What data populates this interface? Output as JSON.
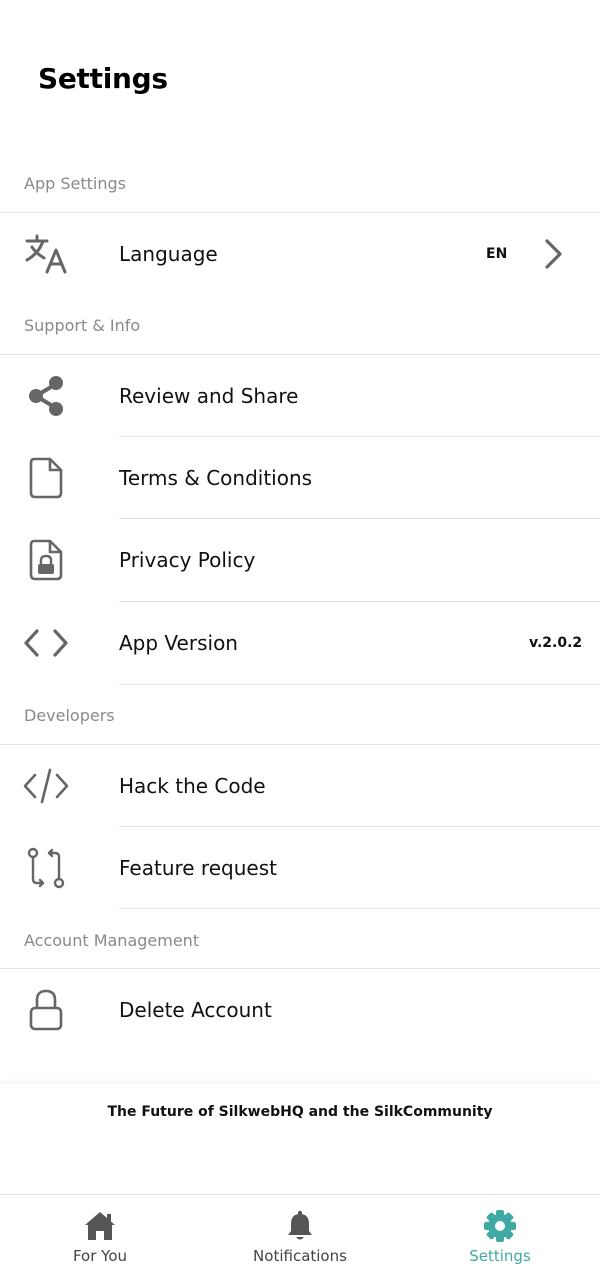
{
  "page": {
    "title": "Settings"
  },
  "sections": {
    "app_settings": "App Settings",
    "support_info": "Support & Info",
    "developers": "Developers",
    "account_management": "Account Management"
  },
  "rows": {
    "language": {
      "label": "Language",
      "value": "EN",
      "icon": "translate-icon"
    },
    "review_share": {
      "label": "Review and Share",
      "icon": "share-icon"
    },
    "terms": {
      "label": "Terms & Conditions",
      "icon": "document-icon"
    },
    "privacy": {
      "label": "Privacy Policy",
      "icon": "lock-document-icon"
    },
    "app_version": {
      "label": "App Version",
      "value": "v.2.0.2",
      "icon": "code-brackets-icon"
    },
    "hack_code": {
      "label": "Hack the Code",
      "icon": "code-slash-icon"
    },
    "feature_request": {
      "label": "Feature request",
      "icon": "pull-request-icon"
    },
    "delete_account": {
      "label": "Delete Account",
      "icon": "lock-icon"
    }
  },
  "footer": {
    "text": "The Future of SilkwebHQ and the SilkCommunity"
  },
  "bottom_nav": {
    "items": [
      {
        "label": "For You",
        "icon": "home-icon",
        "active": false
      },
      {
        "label": "Notifications",
        "icon": "bell-icon",
        "active": false
      },
      {
        "label": "Settings",
        "icon": "gear-icon",
        "active": true
      }
    ]
  },
  "colors": {
    "accent": "#3fa9a3",
    "icon_gray": "#666666",
    "section_header": "#8a8a8a",
    "divider": "#e3e3e3"
  }
}
